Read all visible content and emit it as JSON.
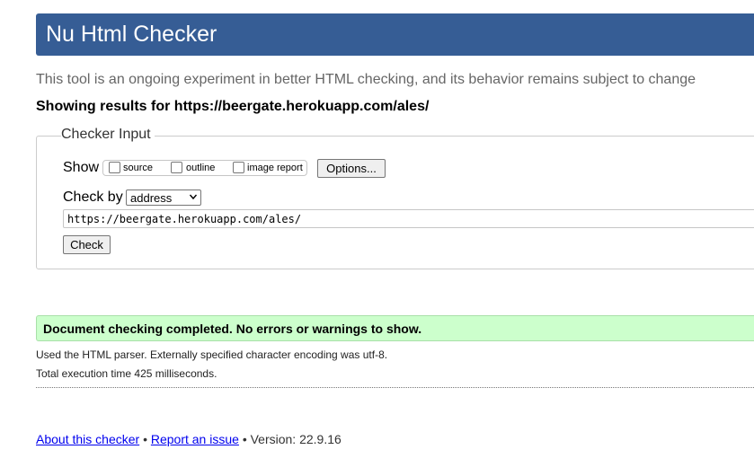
{
  "header": {
    "title": "Nu Html Checker"
  },
  "intro_text": "This tool is an ongoing experiment in better HTML checking, and its behavior remains subject to change",
  "results_heading": "Showing results for https://beergate.herokuapp.com/ales/",
  "checker_input": {
    "legend": "Checker Input",
    "show_label": "Show",
    "show_options": [
      {
        "label": "source",
        "checked": false
      },
      {
        "label": "outline",
        "checked": false
      },
      {
        "label": "image report",
        "checked": false
      }
    ],
    "options_button": "Options...",
    "check_by_label": "Check by",
    "check_by_selected": "address",
    "url_value": "https://beergate.herokuapp.com/ales/",
    "check_button": "Check"
  },
  "result": {
    "success_message": "Document checking completed. No errors or warnings to show.",
    "parser_info": "Used the HTML parser. Externally specified character encoding was utf-8.",
    "execution_time": "Total execution time 425 milliseconds."
  },
  "footer": {
    "about_link": "About this checker",
    "separator": "•",
    "report_link": "Report an issue",
    "version_text": "Version: 22.9.16"
  },
  "colors": {
    "banner": "#365d95",
    "success_bg": "#ccffcc",
    "link": "#0000ee"
  }
}
